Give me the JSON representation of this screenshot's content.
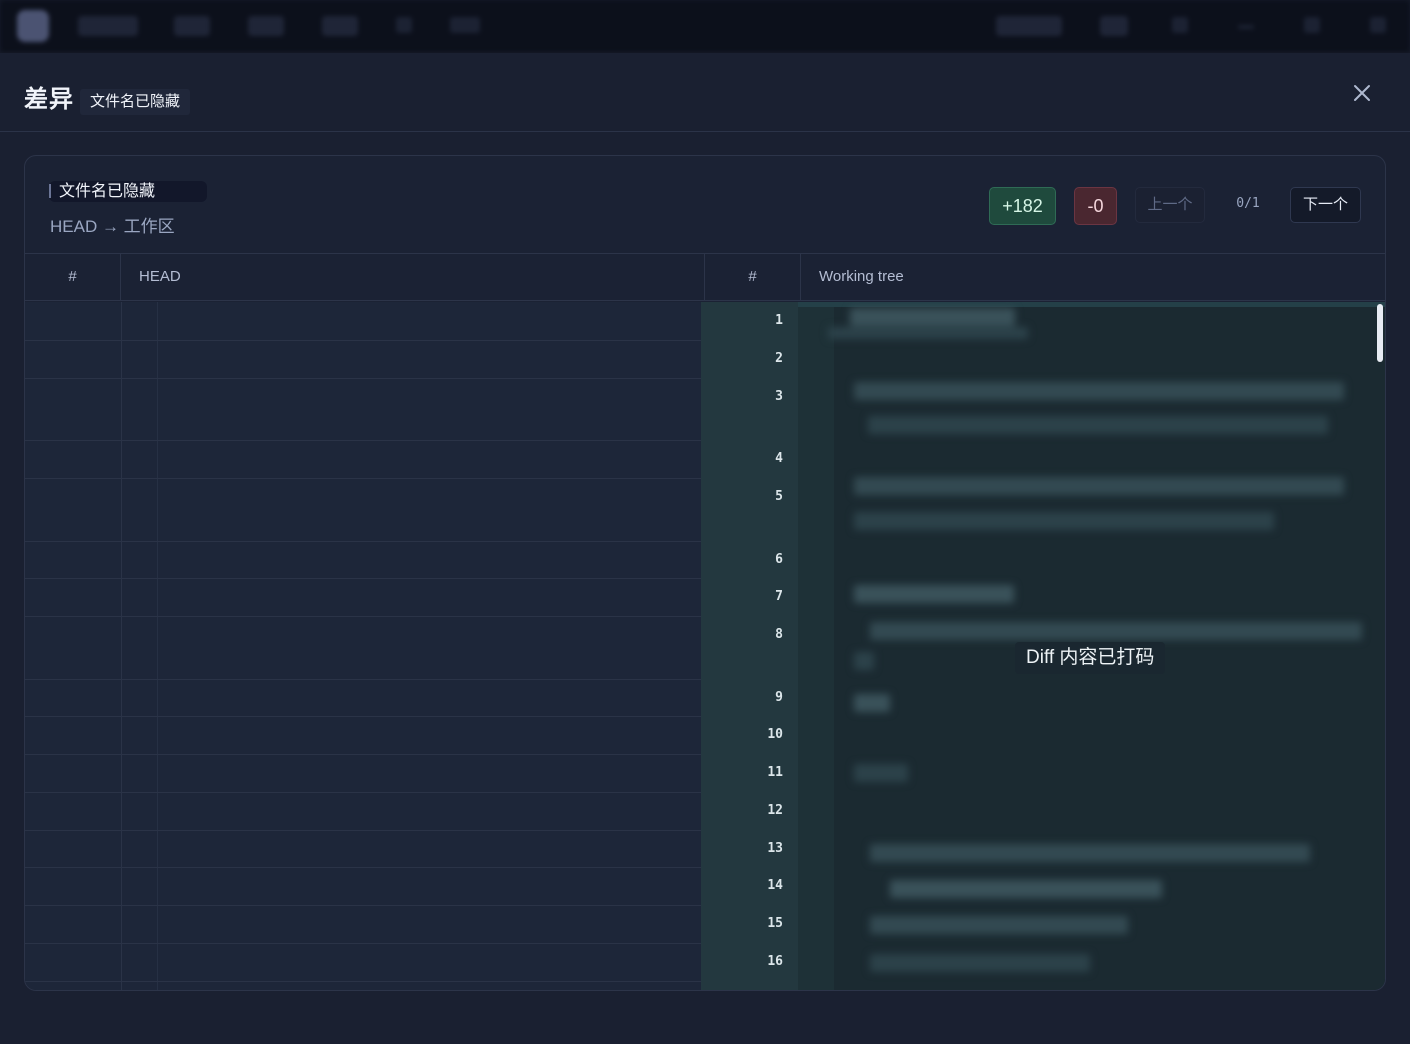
{
  "modal": {
    "title": "差异",
    "file_chip": "文件名已隐藏",
    "close_icon": "close-icon"
  },
  "diff": {
    "file_name": "文件名已隐藏",
    "revisions": "HEAD → 工作区",
    "additions": "+182",
    "deletions": "-0",
    "prev_label": "上一个",
    "counter": "0/1",
    "next_label": "下一个",
    "masked_notice": "Diff 内容已打码",
    "columns": {
      "left_num": "#",
      "left": "HEAD",
      "right_num": "#",
      "right": "Working tree"
    },
    "line_numbers": [
      "1",
      "2",
      "3",
      "4",
      "5",
      "6",
      "7",
      "8",
      "9",
      "10",
      "11",
      "12",
      "13",
      "14",
      "15",
      "16"
    ]
  },
  "colors": {
    "added_badge": "#1f4a3d",
    "deleted_badge": "#4a2730",
    "added_line_gutter": "#23383f"
  }
}
